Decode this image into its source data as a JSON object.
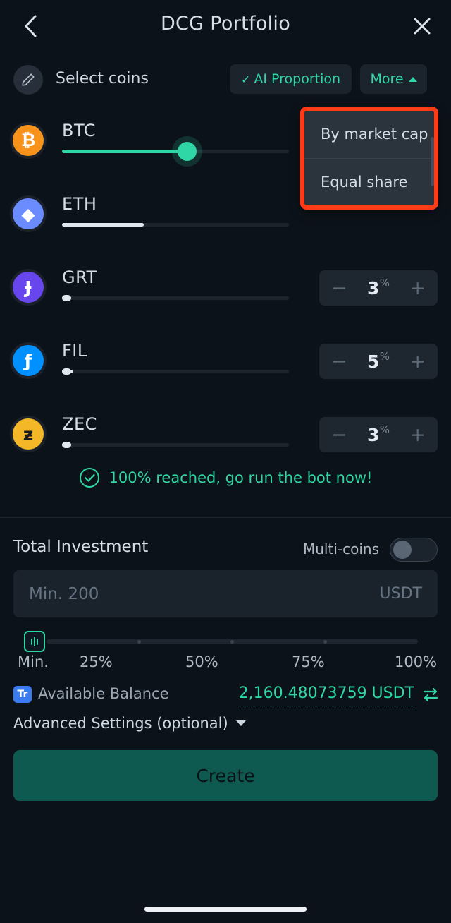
{
  "header": {
    "title": "DCG Portfolio",
    "back_icon": "chevron-left-icon",
    "close_icon": "close-icon"
  },
  "coins_bar": {
    "edit_icon": "pencil-icon",
    "label": "Select coins",
    "ai_proportion": {
      "check": "✓",
      "label": "AI Proportion"
    },
    "more": {
      "label": "More",
      "caret": "caret-up-icon"
    }
  },
  "dropdown": {
    "visible": true,
    "highlighted": true,
    "items": [
      {
        "label": "By market cap"
      },
      {
        "label": "Equal share"
      }
    ]
  },
  "coins": [
    {
      "symbol": "BTC",
      "glyph": "₿",
      "color": "#f7931a",
      "text_color": "#ffffff",
      "slider_pct": 55,
      "fill_color": "#2fd6a6",
      "has_thumb": true,
      "stepper": null
    },
    {
      "symbol": "ETH",
      "glyph": "◆",
      "color": "#6b8cff",
      "text_color": "#ffffff",
      "slider_pct": 36,
      "fill_color": "#dfe6ee",
      "has_thumb": false,
      "stepper": null
    },
    {
      "symbol": "GRT",
      "glyph": "Ɉ",
      "color": "#6747ed",
      "text_color": "#ffffff",
      "slider_pct": 3,
      "fill_color": "#dfe6ee",
      "has_thumb": false,
      "stepper": {
        "minus": "−",
        "value": "3",
        "unit": "%",
        "plus": "+"
      }
    },
    {
      "symbol": "FIL",
      "glyph": "ƒ",
      "color": "#0090ff",
      "text_color": "#ffffff",
      "slider_pct": 5,
      "fill_color": "#dfe6ee",
      "has_thumb": false,
      "stepper": {
        "minus": "−",
        "value": "5",
        "unit": "%",
        "plus": "+"
      }
    },
    {
      "symbol": "ZEC",
      "glyph": "ƶ",
      "color": "#f4b728",
      "text_color": "#1a1a1a",
      "slider_pct": 3,
      "fill_color": "#dfe6ee",
      "has_thumb": false,
      "stepper": {
        "minus": "−",
        "value": "3",
        "unit": "%",
        "plus": "+"
      }
    }
  ],
  "success": {
    "icon": "check-circle-icon",
    "text": "100% reached, go run the bot now!",
    "color": "#2fd6a6"
  },
  "investment": {
    "title": "Total Investment",
    "multi_coins_label": "Multi-coins",
    "multi_coins_on": false,
    "input_placeholder": "Min. 200",
    "input_value": "",
    "unit": "USDT"
  },
  "percent_slider": {
    "handle_icon": "slider-handle-icon",
    "value": "Min.",
    "ticks": [
      "Min.",
      "25%",
      "50%",
      "75%",
      "100%"
    ]
  },
  "balance": {
    "badge": "Tr",
    "label": "Available Balance",
    "value": "2,160.48073759 USDT",
    "swap_icon": "transfer-icon",
    "color": "#2fd6a6"
  },
  "advanced": {
    "label": "Advanced Settings (optional)",
    "caret": "chevron-down-icon"
  },
  "create": {
    "label": "Create"
  },
  "colors": {
    "background": "#0c1219",
    "accent": "#2fd6a6",
    "highlight": "#ff3a17",
    "card": "#1e262f",
    "create_bg": "#0f5a50"
  }
}
